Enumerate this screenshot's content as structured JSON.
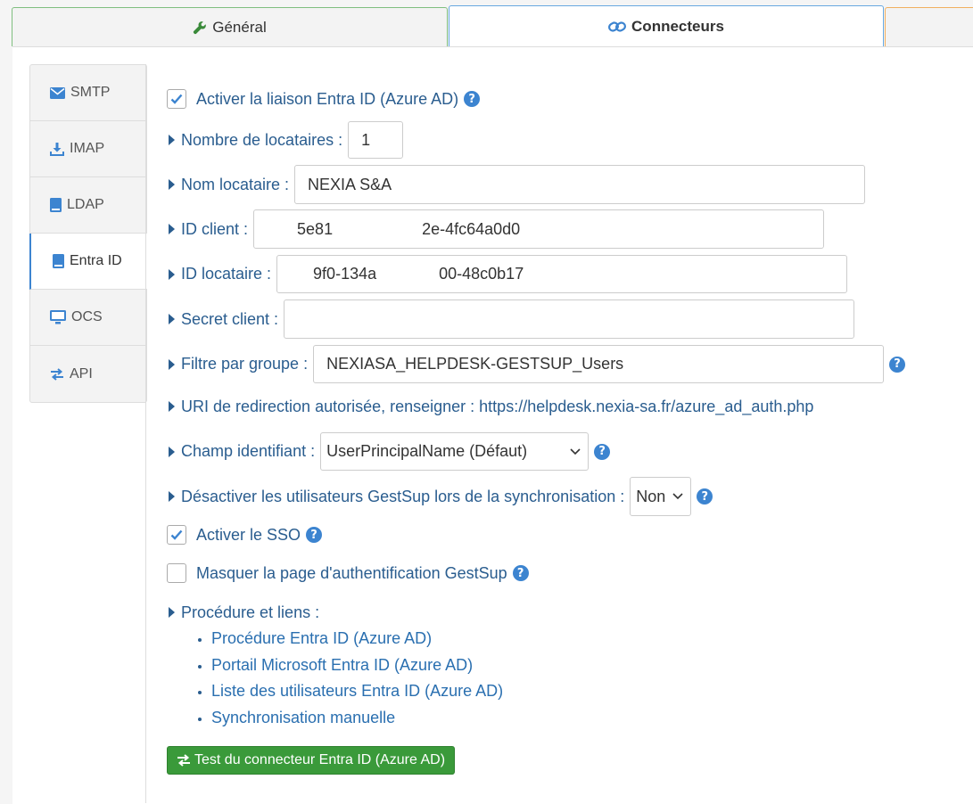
{
  "top_tabs": [
    {
      "label": "Général",
      "icon": "wrench-icon"
    },
    {
      "label": "Connecteurs",
      "icon": "link-icon",
      "active": true
    },
    {
      "label": "",
      "icon": ""
    }
  ],
  "side_tabs": [
    {
      "label": "SMTP",
      "icon": "envelope-icon"
    },
    {
      "label": "IMAP",
      "icon": "download-icon"
    },
    {
      "label": "LDAP",
      "icon": "book-icon"
    },
    {
      "label": "Entra ID",
      "icon": "book-icon",
      "active": true
    },
    {
      "label": "OCS",
      "icon": "desktop-icon"
    },
    {
      "label": "API",
      "icon": "exchange-icon"
    }
  ],
  "form": {
    "enable_link": {
      "label": "Activer la liaison Entra ID (Azure AD)",
      "checked": true
    },
    "tenant_count": {
      "label": "Nombre de locataires :",
      "value": "1"
    },
    "tenant_name": {
      "label": "Nom locataire :",
      "value": "NEXIA S&A"
    },
    "client_id": {
      "label": "ID client :",
      "value": "5e81                    2e-4fc64a0d0"
    },
    "tenant_id": {
      "label": "ID locataire :",
      "value": "9f0-134a              00-48c0b17"
    },
    "client_secret": {
      "label": "Secret client :",
      "value": ""
    },
    "group_filter": {
      "label": "Filtre par groupe :",
      "value": "NEXIASA_HELPDESK-GESTSUP_Users"
    },
    "redirect_uri": {
      "label": "URI de redirection autorisée, renseigner : https://helpdesk.nexia-sa.fr/azure_ad_auth.php"
    },
    "id_field": {
      "label": "Champ identifiant :",
      "value": "UserPrincipalName (Défaut)"
    },
    "disable_users": {
      "label": "Désactiver les utilisateurs GestSup lors de la synchronisation :",
      "value": "Non"
    },
    "enable_sso": {
      "label": "Activer le SSO",
      "checked": true
    },
    "hide_auth": {
      "label": "Masquer la page d'authentification GestSup",
      "checked": false
    },
    "procedure": {
      "label": "Procédure et liens :"
    }
  },
  "links": [
    "Procédure Entra ID (Azure AD)",
    "Portail Microsoft Entra ID (Azure AD)",
    "Liste des utilisateurs Entra ID (Azure AD)",
    "Synchronisation manuelle"
  ],
  "test_button": "Test du connecteur Entra ID (Azure AD)",
  "help_symbol": "?",
  "colors": {
    "accent": "#3c84d0",
    "text": "#2a5d8f",
    "button": "#3a9a3a"
  }
}
